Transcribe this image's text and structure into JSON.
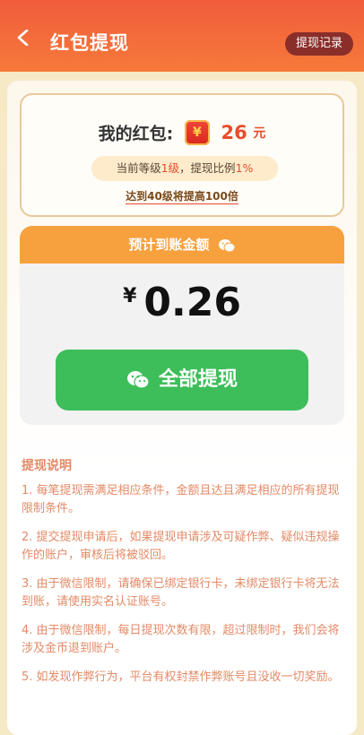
{
  "header": {
    "title": "红包提现",
    "record_label": "提现记录"
  },
  "balance": {
    "label": "我的红包:",
    "amount": "26",
    "unit": "元",
    "coin_icon": "¥"
  },
  "level": {
    "prefix": "当前等级",
    "level_value": "1级",
    "mid": "，提现比例",
    "ratio": "1%"
  },
  "tip": "达到40级将提高100倍",
  "estimate": {
    "header": "预计到账金额",
    "currency": "¥",
    "value": "0.26"
  },
  "withdraw_button": "全部提现",
  "notes": {
    "title": "提现说明",
    "items": [
      "1. 每笔提现需满足相应条件，金额且达且满足相应的所有提现限制条件。",
      "2. 提交提现申请后，如果提现申请涉及可疑作弊、疑似违规操作的账户，审核后将被驳回。",
      "3. 由于微信限制，请确保已绑定银行卡，未绑定银行卡将无法到账，请使用实名认证账号。",
      "4. 由于微信限制，每日提现次数有限，超过限制时，我们会将涉及金币退到账户。",
      "5. 如发现作弊行为，平台有权封禁作弊账号且没收一切奖励。"
    ]
  },
  "colors": {
    "header": "#F25C3C",
    "accent": "#E94C2A",
    "button": "#3DBE5A",
    "estimate_header": "#F7A13E"
  }
}
